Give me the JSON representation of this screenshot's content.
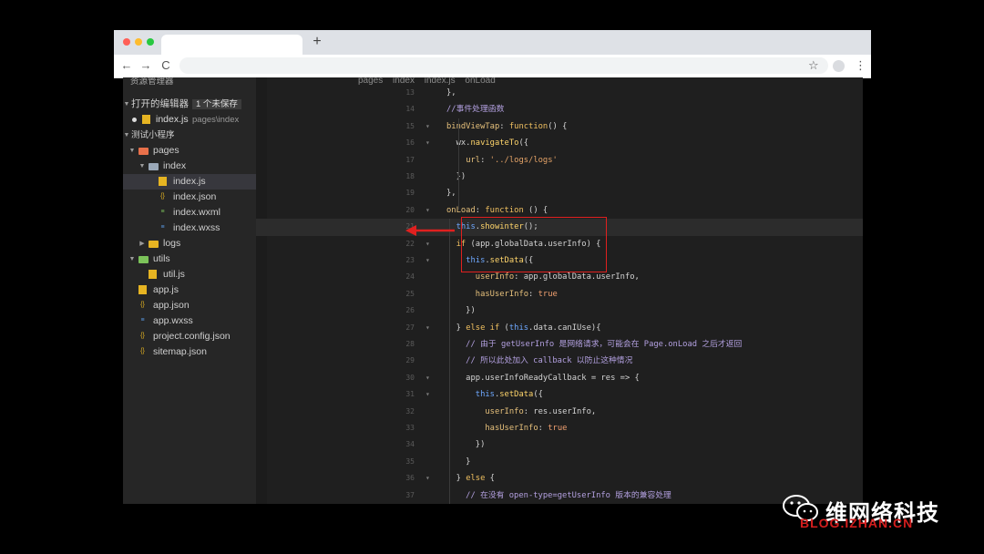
{
  "browser": {
    "new_tab": "+",
    "nav": {
      "back": "←",
      "forward": "→",
      "reload": "C"
    },
    "star": "☆",
    "menu": "⋮"
  },
  "sidebar": {
    "title": "资源管理器",
    "open_editors": {
      "label": "打开的编辑器",
      "badge": "1 个未保存"
    },
    "open_file": {
      "name": "index.js",
      "path": "pages\\index"
    },
    "project": "测试小程序",
    "tree": [
      {
        "label": "pages",
        "kind": "folder",
        "color": "#e8704a"
      },
      {
        "label": "index",
        "kind": "folder",
        "color": "#9aa8b8"
      },
      {
        "label": "index.js",
        "kind": "js",
        "color": "#e6b422"
      },
      {
        "label": "index.json",
        "kind": "json",
        "color": "#e6b422"
      },
      {
        "label": "index.wxml",
        "kind": "wxml",
        "color": "#7cc35a"
      },
      {
        "label": "index.wxss",
        "kind": "wxss",
        "color": "#5a9be6"
      },
      {
        "label": "logs",
        "kind": "folder",
        "color": "#e6b422"
      },
      {
        "label": "utils",
        "kind": "folder",
        "color": "#7cc35a"
      },
      {
        "label": "util.js",
        "kind": "js",
        "color": "#e6b422"
      },
      {
        "label": "app.js",
        "kind": "js",
        "color": "#e6b422"
      },
      {
        "label": "app.json",
        "kind": "json",
        "color": "#e6b422"
      },
      {
        "label": "app.wxss",
        "kind": "wxss",
        "color": "#5a9be6"
      },
      {
        "label": "project.config.json",
        "kind": "json",
        "color": "#e6b422"
      },
      {
        "label": "sitemap.json",
        "kind": "json",
        "color": "#e6b422"
      }
    ]
  },
  "breadcrumb": [
    "pages",
    "index",
    "index.js",
    "onLoad"
  ],
  "editor": {
    "current_line": 21,
    "lines": [
      {
        "n": "13",
        "fold": false,
        "code": "},"
      },
      {
        "n": "14",
        "fold": false,
        "code": "//事件处理函数"
      },
      {
        "n": "15",
        "fold": true,
        "code": "bindViewTap: function() {"
      },
      {
        "n": "16",
        "fold": true,
        "code": "  wx.navigateTo({"
      },
      {
        "n": "17",
        "fold": false,
        "code": "    url: '../logs/logs'"
      },
      {
        "n": "18",
        "fold": false,
        "code": "  })"
      },
      {
        "n": "19",
        "fold": false,
        "code": "},"
      },
      {
        "n": "20",
        "fold": true,
        "code": "onLoad: function () {"
      },
      {
        "n": "21",
        "fold": false,
        "code": "  this.showinter();"
      },
      {
        "n": "22",
        "fold": true,
        "code": "  if (app.globalData.userInfo) {"
      },
      {
        "n": "23",
        "fold": true,
        "code": "    this.setData({"
      },
      {
        "n": "24",
        "fold": false,
        "code": "      userInfo: app.globalData.userInfo,"
      },
      {
        "n": "25",
        "fold": false,
        "code": "      hasUserInfo: true"
      },
      {
        "n": "26",
        "fold": false,
        "code": "    })"
      },
      {
        "n": "27",
        "fold": true,
        "code": "  } else if (this.data.canIUse){"
      },
      {
        "n": "28",
        "fold": false,
        "code": "    // 由于 getUserInfo 是网络请求，可能会在 Page.onLoad 之后才返回"
      },
      {
        "n": "29",
        "fold": false,
        "code": "    // 所以此处加入 callback 以防止这种情况"
      },
      {
        "n": "30",
        "fold": true,
        "code": "    app.userInfoReadyCallback = res => {"
      },
      {
        "n": "31",
        "fold": true,
        "code": "      this.setData({"
      },
      {
        "n": "32",
        "fold": false,
        "code": "        userInfo: res.userInfo,"
      },
      {
        "n": "33",
        "fold": false,
        "code": "        hasUserInfo: true"
      },
      {
        "n": "34",
        "fold": false,
        "code": "      })"
      },
      {
        "n": "35",
        "fold": false,
        "code": "    }"
      },
      {
        "n": "36",
        "fold": true,
        "code": "  } else {"
      },
      {
        "n": "37",
        "fold": false,
        "code": "    // 在没有 open-type=getUserInfo 版本的兼容处理"
      }
    ]
  },
  "watermark": {
    "brand": "维网络科技",
    "domain": "BLOG.IZHAN.CN"
  },
  "colors": {
    "annotation": "#e0201f"
  }
}
